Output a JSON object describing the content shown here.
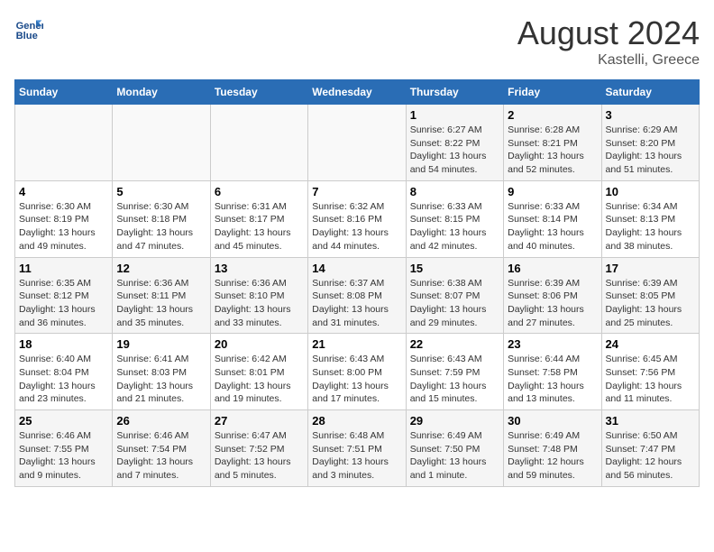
{
  "header": {
    "logo_line1": "General",
    "logo_line2": "Blue",
    "month_title": "August 2024",
    "location": "Kastelli, Greece"
  },
  "calendar": {
    "days_of_week": [
      "Sunday",
      "Monday",
      "Tuesday",
      "Wednesday",
      "Thursday",
      "Friday",
      "Saturday"
    ],
    "weeks": [
      [
        {
          "day": "",
          "info": ""
        },
        {
          "day": "",
          "info": ""
        },
        {
          "day": "",
          "info": ""
        },
        {
          "day": "",
          "info": ""
        },
        {
          "day": "1",
          "info": "Sunrise: 6:27 AM\nSunset: 8:22 PM\nDaylight: 13 hours\nand 54 minutes."
        },
        {
          "day": "2",
          "info": "Sunrise: 6:28 AM\nSunset: 8:21 PM\nDaylight: 13 hours\nand 52 minutes."
        },
        {
          "day": "3",
          "info": "Sunrise: 6:29 AM\nSunset: 8:20 PM\nDaylight: 13 hours\nand 51 minutes."
        }
      ],
      [
        {
          "day": "4",
          "info": "Sunrise: 6:30 AM\nSunset: 8:19 PM\nDaylight: 13 hours\nand 49 minutes."
        },
        {
          "day": "5",
          "info": "Sunrise: 6:30 AM\nSunset: 8:18 PM\nDaylight: 13 hours\nand 47 minutes."
        },
        {
          "day": "6",
          "info": "Sunrise: 6:31 AM\nSunset: 8:17 PM\nDaylight: 13 hours\nand 45 minutes."
        },
        {
          "day": "7",
          "info": "Sunrise: 6:32 AM\nSunset: 8:16 PM\nDaylight: 13 hours\nand 44 minutes."
        },
        {
          "day": "8",
          "info": "Sunrise: 6:33 AM\nSunset: 8:15 PM\nDaylight: 13 hours\nand 42 minutes."
        },
        {
          "day": "9",
          "info": "Sunrise: 6:33 AM\nSunset: 8:14 PM\nDaylight: 13 hours\nand 40 minutes."
        },
        {
          "day": "10",
          "info": "Sunrise: 6:34 AM\nSunset: 8:13 PM\nDaylight: 13 hours\nand 38 minutes."
        }
      ],
      [
        {
          "day": "11",
          "info": "Sunrise: 6:35 AM\nSunset: 8:12 PM\nDaylight: 13 hours\nand 36 minutes."
        },
        {
          "day": "12",
          "info": "Sunrise: 6:36 AM\nSunset: 8:11 PM\nDaylight: 13 hours\nand 35 minutes."
        },
        {
          "day": "13",
          "info": "Sunrise: 6:36 AM\nSunset: 8:10 PM\nDaylight: 13 hours\nand 33 minutes."
        },
        {
          "day": "14",
          "info": "Sunrise: 6:37 AM\nSunset: 8:08 PM\nDaylight: 13 hours\nand 31 minutes."
        },
        {
          "day": "15",
          "info": "Sunrise: 6:38 AM\nSunset: 8:07 PM\nDaylight: 13 hours\nand 29 minutes."
        },
        {
          "day": "16",
          "info": "Sunrise: 6:39 AM\nSunset: 8:06 PM\nDaylight: 13 hours\nand 27 minutes."
        },
        {
          "day": "17",
          "info": "Sunrise: 6:39 AM\nSunset: 8:05 PM\nDaylight: 13 hours\nand 25 minutes."
        }
      ],
      [
        {
          "day": "18",
          "info": "Sunrise: 6:40 AM\nSunset: 8:04 PM\nDaylight: 13 hours\nand 23 minutes."
        },
        {
          "day": "19",
          "info": "Sunrise: 6:41 AM\nSunset: 8:03 PM\nDaylight: 13 hours\nand 21 minutes."
        },
        {
          "day": "20",
          "info": "Sunrise: 6:42 AM\nSunset: 8:01 PM\nDaylight: 13 hours\nand 19 minutes."
        },
        {
          "day": "21",
          "info": "Sunrise: 6:43 AM\nSunset: 8:00 PM\nDaylight: 13 hours\nand 17 minutes."
        },
        {
          "day": "22",
          "info": "Sunrise: 6:43 AM\nSunset: 7:59 PM\nDaylight: 13 hours\nand 15 minutes."
        },
        {
          "day": "23",
          "info": "Sunrise: 6:44 AM\nSunset: 7:58 PM\nDaylight: 13 hours\nand 13 minutes."
        },
        {
          "day": "24",
          "info": "Sunrise: 6:45 AM\nSunset: 7:56 PM\nDaylight: 13 hours\nand 11 minutes."
        }
      ],
      [
        {
          "day": "25",
          "info": "Sunrise: 6:46 AM\nSunset: 7:55 PM\nDaylight: 13 hours\nand 9 minutes."
        },
        {
          "day": "26",
          "info": "Sunrise: 6:46 AM\nSunset: 7:54 PM\nDaylight: 13 hours\nand 7 minutes."
        },
        {
          "day": "27",
          "info": "Sunrise: 6:47 AM\nSunset: 7:52 PM\nDaylight: 13 hours\nand 5 minutes."
        },
        {
          "day": "28",
          "info": "Sunrise: 6:48 AM\nSunset: 7:51 PM\nDaylight: 13 hours\nand 3 minutes."
        },
        {
          "day": "29",
          "info": "Sunrise: 6:49 AM\nSunset: 7:50 PM\nDaylight: 13 hours\nand 1 minute."
        },
        {
          "day": "30",
          "info": "Sunrise: 6:49 AM\nSunset: 7:48 PM\nDaylight: 12 hours\nand 59 minutes."
        },
        {
          "day": "31",
          "info": "Sunrise: 6:50 AM\nSunset: 7:47 PM\nDaylight: 12 hours\nand 56 minutes."
        }
      ]
    ]
  }
}
